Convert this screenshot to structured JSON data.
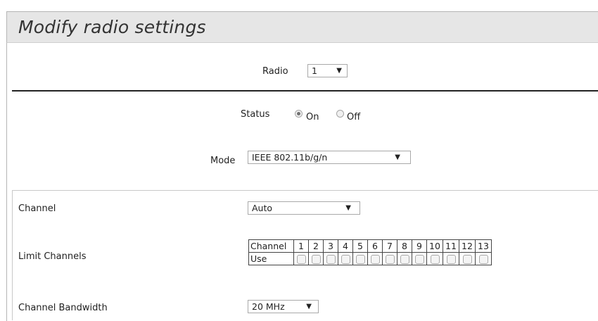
{
  "page": {
    "title": "Modify radio settings"
  },
  "radio": {
    "label": "Radio",
    "value": "1"
  },
  "status": {
    "label": "Status",
    "on_label": "On",
    "off_label": "Off",
    "selected": "On"
  },
  "mode": {
    "label": "Mode",
    "value": "IEEE 802.11b/g/n"
  },
  "channel": {
    "label": "Channel",
    "value": "Auto"
  },
  "limit_channels": {
    "label": "Limit Channels",
    "header_label": "Channel",
    "use_label": "Use",
    "channels": [
      "1",
      "2",
      "3",
      "4",
      "5",
      "6",
      "7",
      "8",
      "9",
      "10",
      "11",
      "12",
      "13"
    ]
  },
  "bandwidth": {
    "label": "Channel Bandwidth",
    "value": "20 MHz"
  },
  "icons": {
    "dropdown": "chevron-down-icon"
  }
}
